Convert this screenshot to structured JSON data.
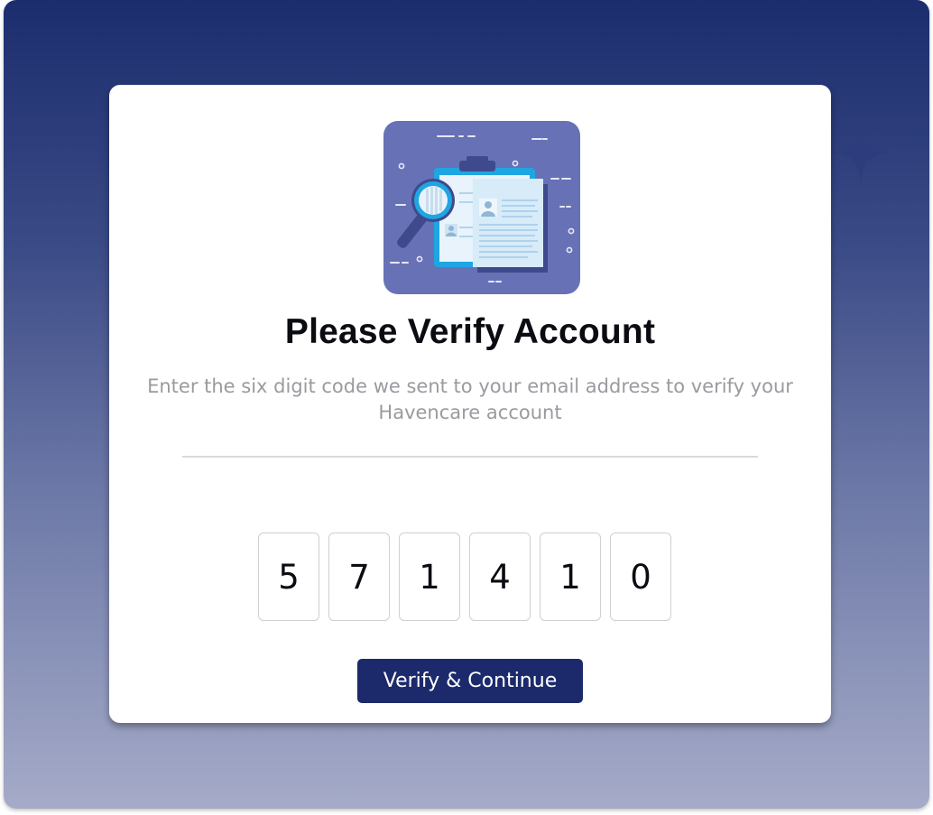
{
  "page": {
    "title": "Please Verify Account",
    "subtitle": "Enter the six digit code we sent to your email address to verify your Havencare account"
  },
  "illustration": {
    "icon": "document-search-illustration",
    "background_color": "#6771b6"
  },
  "otp": {
    "digits": [
      "5",
      "7",
      "1",
      "4",
      "1",
      "0"
    ]
  },
  "actions": {
    "verify_label": "Verify & Continue",
    "button_color": "#1c2a6c"
  },
  "theme": {
    "background_top": "#1c2d6e",
    "background_bottom": "#a5abc8",
    "sparkle_icon": "four-point-star-icon"
  }
}
